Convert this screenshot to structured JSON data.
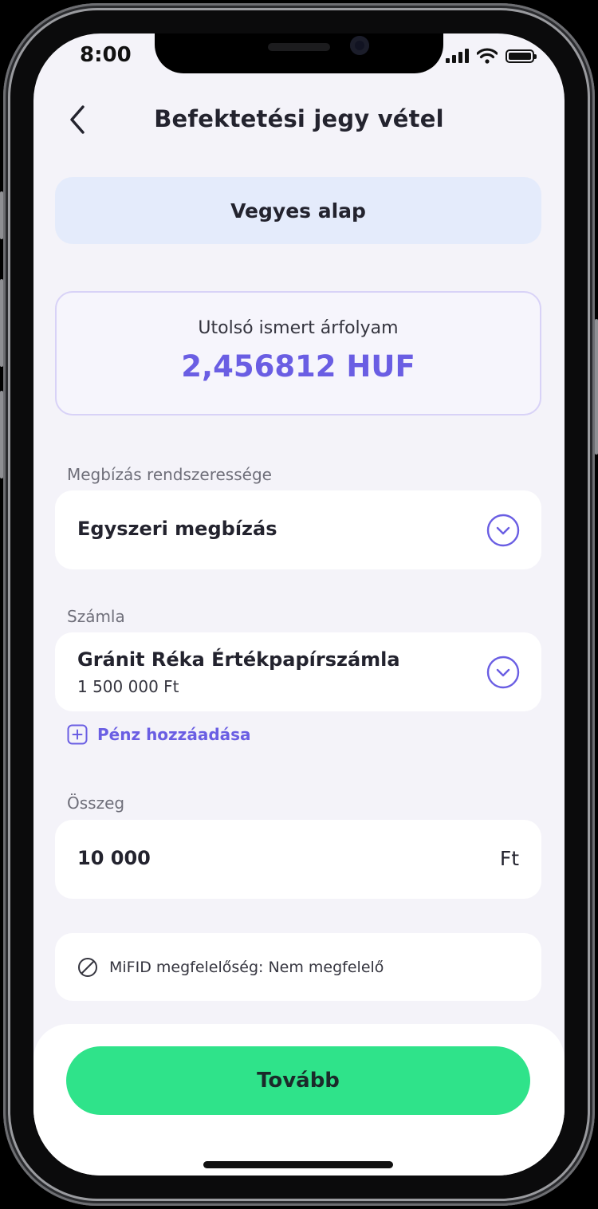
{
  "status_bar": {
    "time": "8:00",
    "icons": [
      "signal-icon",
      "wifi-icon",
      "battery-icon"
    ]
  },
  "header": {
    "title": "Befektetési jegy vétel",
    "back_icon": "chevron-left-icon"
  },
  "fund": {
    "name": "Vegyes alap"
  },
  "rate": {
    "label": "Utolsó ismert árfolyam",
    "value": "2,456812 HUF"
  },
  "frequency": {
    "label": "Megbízás rendszeressége",
    "value": "Egyszeri megbízás",
    "icon": "chevron-down-icon"
  },
  "account": {
    "label": "Számla",
    "name": "Gránit Réka Értékpapírszámla",
    "balance": "1 500 000 Ft",
    "icon": "chevron-down-icon"
  },
  "add_money": {
    "label": "Pénz hozzáadása",
    "icon": "plus-square-icon"
  },
  "amount": {
    "label": "Összeg",
    "value": "10 000",
    "unit": "Ft"
  },
  "mifid": {
    "text": "MiFID megfelelőség: Nem megfelelő",
    "icon": "prohibited-icon"
  },
  "cta": {
    "label": "Tovább"
  },
  "colors": {
    "accent": "#6a5ee3",
    "primary_button": "#2fe38a",
    "fund_bg": "#e4ebfb",
    "screen_bg": "#f4f3f9"
  }
}
